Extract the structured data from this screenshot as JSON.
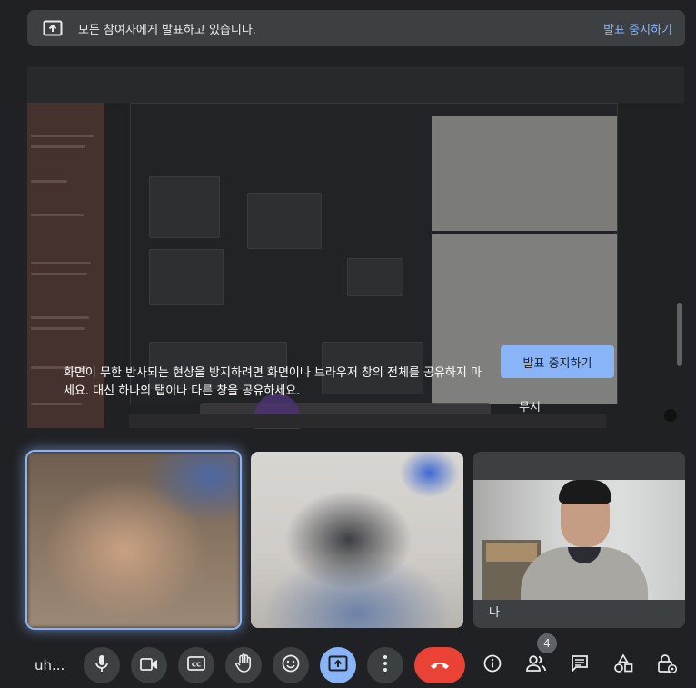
{
  "banner": {
    "message": "모든 참여자에게 발표하고 있습니다.",
    "stop_label": "발표 중지하기",
    "icon": "present-screen-icon"
  },
  "warning": {
    "message": "화면이 무한 반사되는 현상을 방지하려면 화면이나 브라우저 창의 전체를 공유하지 마세요. 대신 하나의 탭이나 다른 창을 공유하세요.",
    "stop_label": "발표 중지하기",
    "dismiss_label": "무시"
  },
  "tiles": {
    "self_label": "나"
  },
  "controls": {
    "name": "uh...",
    "participant_count": "4",
    "icons": [
      "mic-icon",
      "camera-icon",
      "captions-icon",
      "raise-hand-icon",
      "emoji-icon",
      "present-icon",
      "more-icon",
      "end-call-icon",
      "info-icon",
      "people-icon",
      "chat-icon",
      "activities-icon",
      "host-controls-icon"
    ]
  },
  "colors": {
    "accent": "#8ab4f8",
    "end_call": "#ea4335",
    "background": "#202124"
  }
}
